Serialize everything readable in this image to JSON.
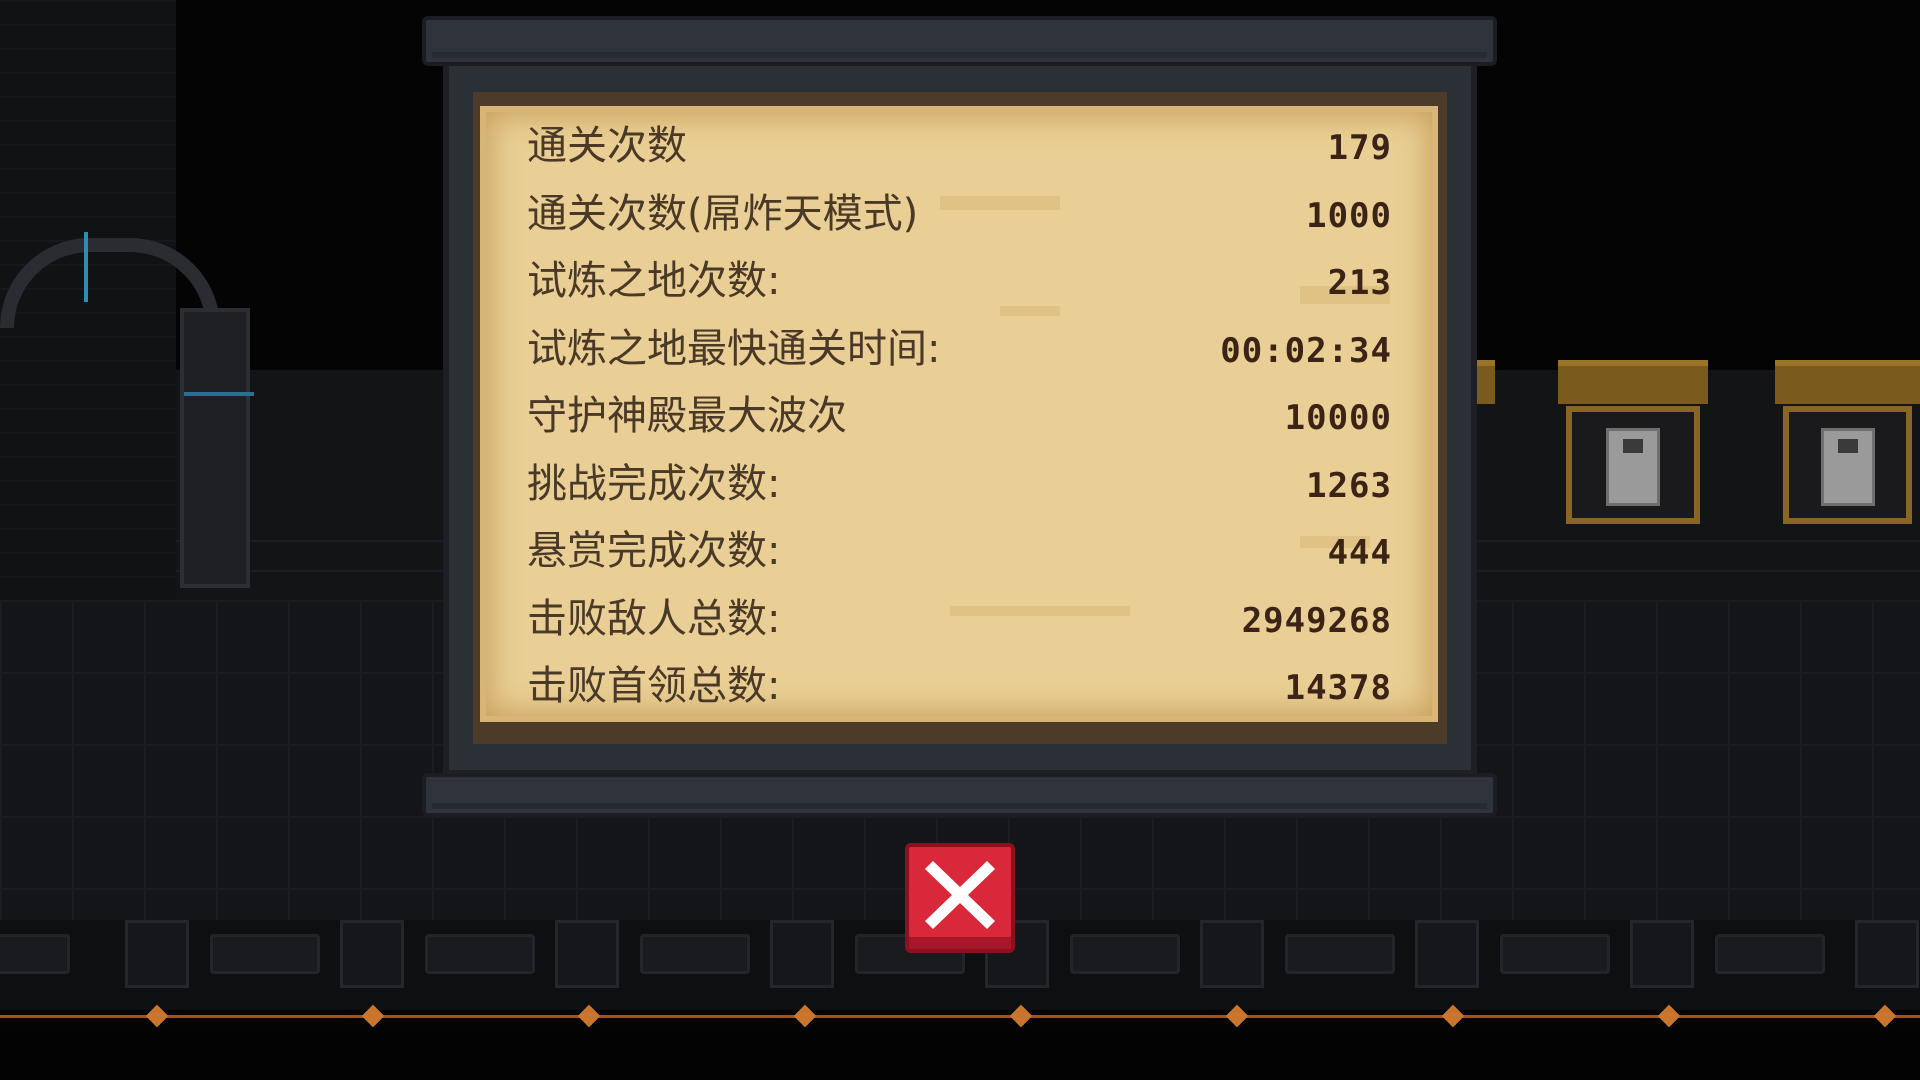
{
  "stats_panel": {
    "rows": [
      {
        "label": "通关次数",
        "value": "179"
      },
      {
        "label": "通关次数(屌炸天模式)",
        "value": "1000"
      },
      {
        "label": "试炼之地次数:",
        "value": "213"
      },
      {
        "label": "试炼之地最快通关时间:",
        "value": "00:02:34"
      },
      {
        "label": "守护神殿最大波次",
        "value": "10000"
      },
      {
        "label": "挑战完成次数:",
        "value": "1263"
      },
      {
        "label": "悬赏完成次数:",
        "value": "444"
      },
      {
        "label": "击败敌人总数:",
        "value": "2949268"
      },
      {
        "label": "击败首领总数:",
        "value": "14378"
      }
    ]
  },
  "close_button": {
    "icon": "close-icon",
    "color": "#d8283a"
  },
  "colors": {
    "parchment": "#e9cf95",
    "text": "#4a3926",
    "frame": "#2f333b"
  }
}
